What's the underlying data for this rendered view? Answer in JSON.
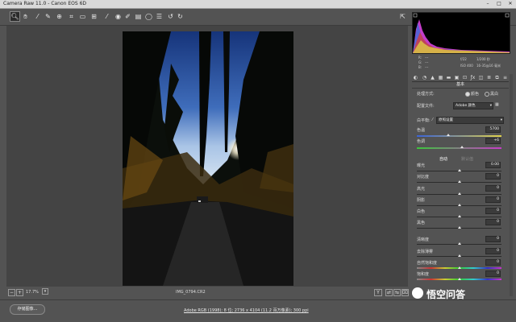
{
  "window": {
    "title": "Camera Raw 11.0 - Canon EOS 6D"
  },
  "toolbar": {
    "icons": [
      "zoom-tool",
      "hand-tool",
      "white-balance-tool",
      "color-sampler-tool",
      "targeted-adjustment-tool",
      "crop-tool",
      "straighten-tool",
      "transform-tool",
      "spot-removal-tool",
      "red-eye-tool",
      "adjustment-brush",
      "graduated-filter",
      "radial-filter",
      "open-preferences",
      "rotate-ccw",
      "rotate-cw"
    ]
  },
  "camera_info": {
    "rgb_r": "R:",
    "rgb_g": "G:",
    "rgb_b": "B:",
    "dash": "---",
    "aperture": "f/22",
    "shutter": "1/200 秒",
    "iso": "ISO 400",
    "lens": "16-35@16 毫米"
  },
  "panel": {
    "title": "基本",
    "treatment_label": "处理方式:",
    "color_option": "颜色",
    "bw_option": "黑白",
    "profile_label": "配置文件:",
    "profile_value": "Adobe 颜色",
    "wb_label": "白平衡:",
    "wb_value": "原照设置",
    "temp_label": "色温",
    "temp_value": "5700",
    "tint_label": "色调",
    "tint_value": "+6",
    "auto_label": "自动",
    "default_label": "默认值",
    "sliders": [
      {
        "label": "曝光",
        "value": "0.00"
      },
      {
        "label": "对比度",
        "value": "0"
      },
      {
        "label": "高光",
        "value": "0"
      },
      {
        "label": "阴影",
        "value": "0"
      },
      {
        "label": "白色",
        "value": "0"
      },
      {
        "label": "黑色",
        "value": "0"
      }
    ],
    "presence": [
      {
        "label": "清晰度",
        "value": "0"
      },
      {
        "label": "去除薄雾",
        "value": "0"
      },
      {
        "label": "自然饱和度",
        "value": "0"
      },
      {
        "label": "饱和度",
        "value": "0"
      }
    ]
  },
  "status": {
    "zoom": "17.7%",
    "filename": "IMG_0794.CR2"
  },
  "bottom": {
    "save_button": "存储图像...",
    "info_link": "Adobe RGB (1998); 8 位; 2736 x 4104 (11.2 百万像素); 300 ppi"
  },
  "watermark": {
    "text": "悟空问答"
  },
  "colors": {
    "bg": "#535353",
    "canvas": "#444444",
    "sky": "#1d3f8a",
    "accent": "#e6e6e6"
  }
}
